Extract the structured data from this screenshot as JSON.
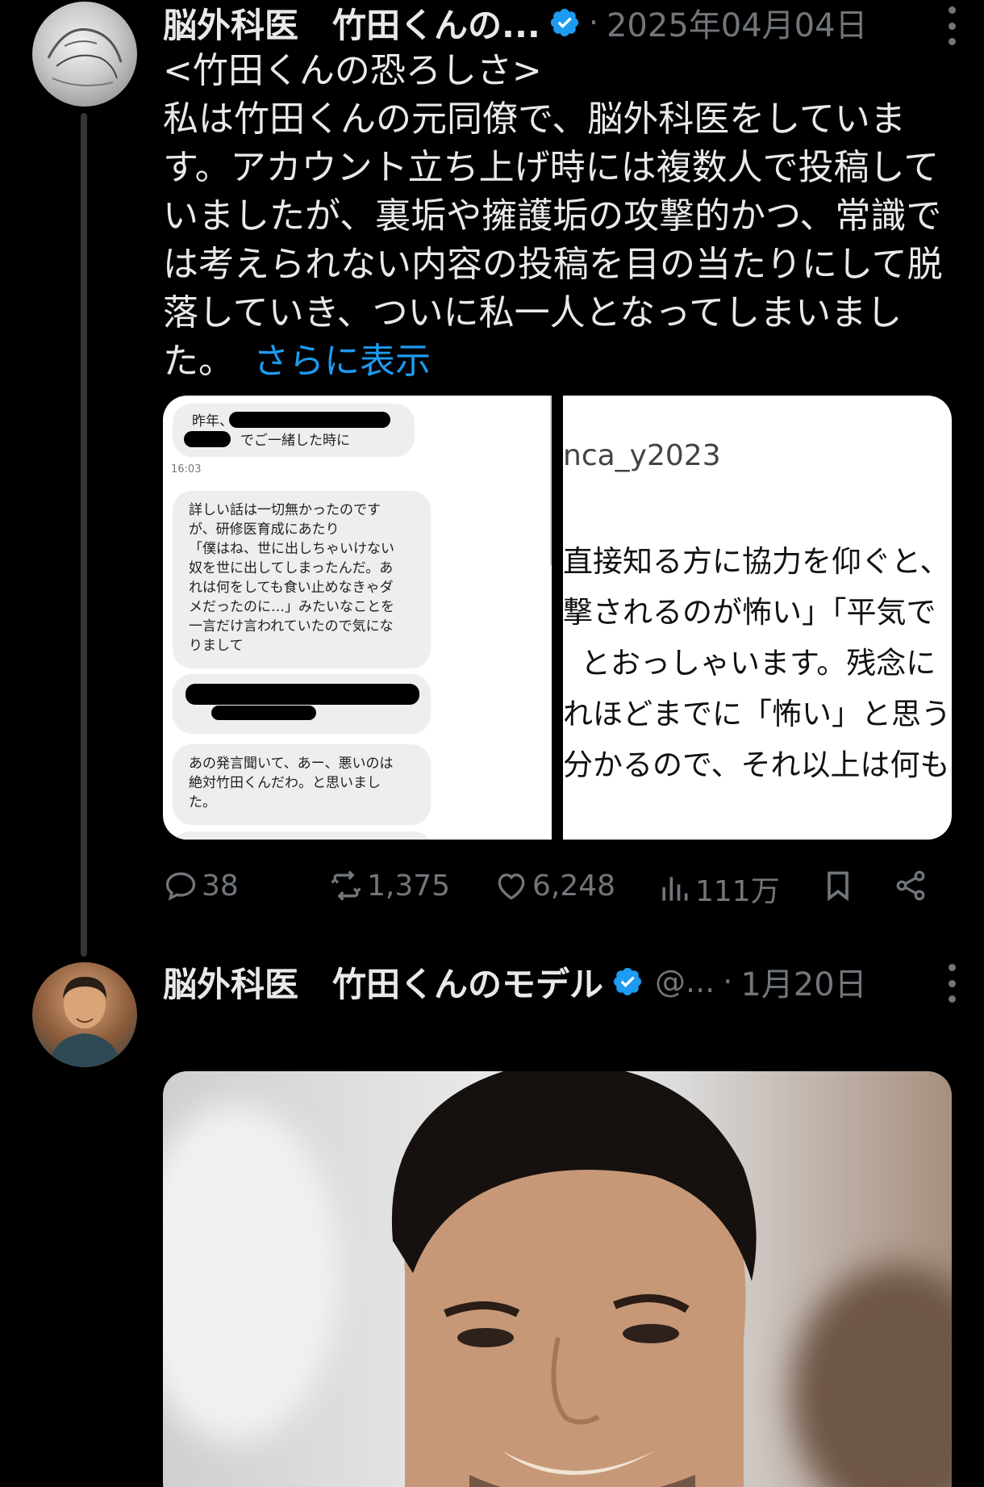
{
  "tweet1": {
    "author_name": "脳外科医　竹田くんの...",
    "date": "2025年04月04日",
    "text_lines": [
      "<竹田くんの恐ろしさ>",
      "私は竹田くんの元同僚で、脳外科医をしていま",
      "す。アカウント立ち上げ時には複数人で投稿して",
      "いましたが、裏垢や擁護垢の攻撃的かつ、常識で",
      "は考えられない内容の投稿を目の当たりにして脱",
      "落していき、ついに私一人となってしまいまし"
    ],
    "last_line": "た。",
    "show_more": "さらに表示",
    "left_image": {
      "bubble1_line1": "昨年、",
      "bubble1_line2": "でご一緒した時に",
      "time": "16:03",
      "bubble2_lines": [
        "詳しい話は一切無かったのです",
        "が、研修医育成にあたり",
        "「僕はね、世に出しちゃいけない",
        "奴を世に出してしまったんだ。あ",
        "れは何をしても食い止めなきゃダ",
        "メだったのに…」みたいなことを",
        "一言だけ言われていたので気にな",
        "りまして"
      ],
      "bubble3_lines": [
        "あの発言聞いて、あー、悪いのは",
        "絶対竹田くんだわ。と思いまし",
        "た。"
      ]
    },
    "right_image": {
      "handle": "nca_y2023",
      "lines": [
        "直接知る方に協力を仰ぐと、",
        "撃されるのが怖い」「平気で",
        "とおっしゃいます。残念に",
        "れほどまでに「怖い」と思う",
        "分かるので、それ以上は何も"
      ]
    },
    "actions": {
      "replies": "38",
      "retweets": "1,375",
      "likes": "6,248",
      "views": "111万"
    }
  },
  "tweet2": {
    "author_name": "脳外科医　竹田くんのモデル",
    "handle": "@...",
    "date": "1月20日"
  },
  "colors": {
    "background": "#000000",
    "text": "#e7e9ea",
    "muted": "#71767b",
    "link": "#1d9bf0",
    "verified": "#1d9bf0"
  }
}
